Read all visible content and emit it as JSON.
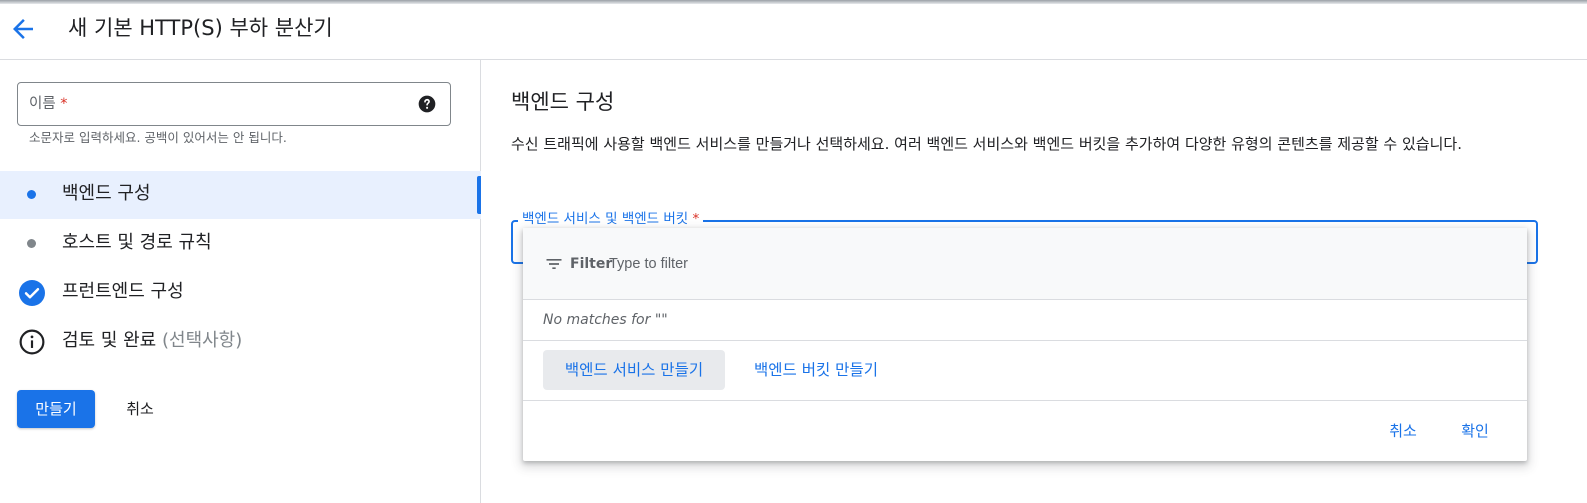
{
  "header": {
    "title": "새 기본 HTTP(S) 부하 분산기",
    "back_icon": "arrow-back-icon"
  },
  "sidebar": {
    "name_field": {
      "label": "이름",
      "required_mark": "*",
      "hint": "소문자로 입력하세요. 공백이 있어서는 안 됩니다.",
      "help_icon": "help-icon"
    },
    "steps": [
      {
        "label": "백엔드 구성",
        "icon": "dot-icon",
        "active": true
      },
      {
        "label": "호스트 및 경로 규칙",
        "icon": "dot-icon",
        "active": false
      },
      {
        "label": "프런트엔드 구성",
        "icon": "check-circle-icon",
        "active": false
      },
      {
        "label": "검토 및 완료",
        "optional": "(선택사항)",
        "icon": "info-icon",
        "active": false
      }
    ],
    "create_label": "만들기",
    "cancel_label": "취소"
  },
  "main": {
    "title": "백엔드 구성",
    "description": "수신 트래픽에 사용할 백엔드 서비스를 만들거나 선택하세요. 여러 백엔드 서비스와 백엔드 버킷을 추가하여 다양한 유형의 콘텐츠를 제공할 수 있습니다.",
    "select_label": "백엔드 서비스 및 백엔드 버킷",
    "select_required_mark": "*",
    "dropdown": {
      "filter_label": "Filter",
      "filter_placeholder": "Type to filter",
      "no_matches": "No matches for \"\"",
      "create_service_label": "백엔드 서비스 만들기",
      "create_bucket_label": "백엔드 버킷 만들기",
      "cancel_label": "취소",
      "ok_label": "확인"
    }
  },
  "colors": {
    "accent": "#1a73e8",
    "active_bg": "#e8f0fe",
    "required": "#d93025",
    "muted": "#5f6368"
  }
}
